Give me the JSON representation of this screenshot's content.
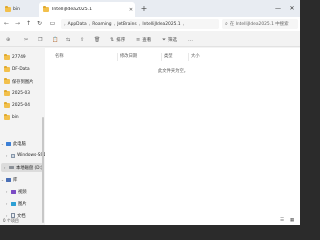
{
  "titlebar": {
    "prev_tab_label": "bin",
    "active_tab_label": "IntelliJIdea2025.1",
    "new_tab_glyph": "+",
    "minimize_glyph": "—",
    "close_glyph": "✕"
  },
  "address": {
    "glyph_back": "←",
    "glyph_forward": "→",
    "glyph_up": "↑",
    "glyph_refresh": "↻",
    "glyph_monitor": "▭",
    "glyph_chevron": "›",
    "glyph_more": "…",
    "path": [
      "AppData",
      "Roaming",
      "JetBrains",
      "IntelliJIdea2025.1"
    ],
    "search_placeholder": "在 IntelliJIdea2025.1 中搜索"
  },
  "cmdbar": {
    "new_glyph": "⊕",
    "cut_glyph": "✂",
    "copy_glyph": "❐",
    "paste_glyph": "📋",
    "rename_glyph": "⇆",
    "share_glyph": "⇪",
    "delete_glyph": "🗑",
    "sort_glyph": "⇅",
    "sort_label": "排序",
    "view_glyph": "≡",
    "view_label": "查看",
    "filter_glyph": "⏷",
    "filter_label": "筛选",
    "more_glyph": "…"
  },
  "sidebar": {
    "folders": [
      "27749",
      "DF-Data",
      "保存到图片",
      "2025-03",
      "2025-04",
      "bin"
    ],
    "this_pc_label": "此电脑",
    "drives": [
      "Windows-SS1",
      "本地磁盘 (D:)"
    ],
    "libraries_label": "库",
    "libraries": [
      "视频",
      "图片",
      "文档"
    ]
  },
  "columns": {
    "name": "名称",
    "date_modified": "修改日期",
    "type": "类型",
    "size": "大小"
  },
  "empty_message": "此文件夹为空。",
  "status": {
    "item_count": "0 个项目"
  }
}
